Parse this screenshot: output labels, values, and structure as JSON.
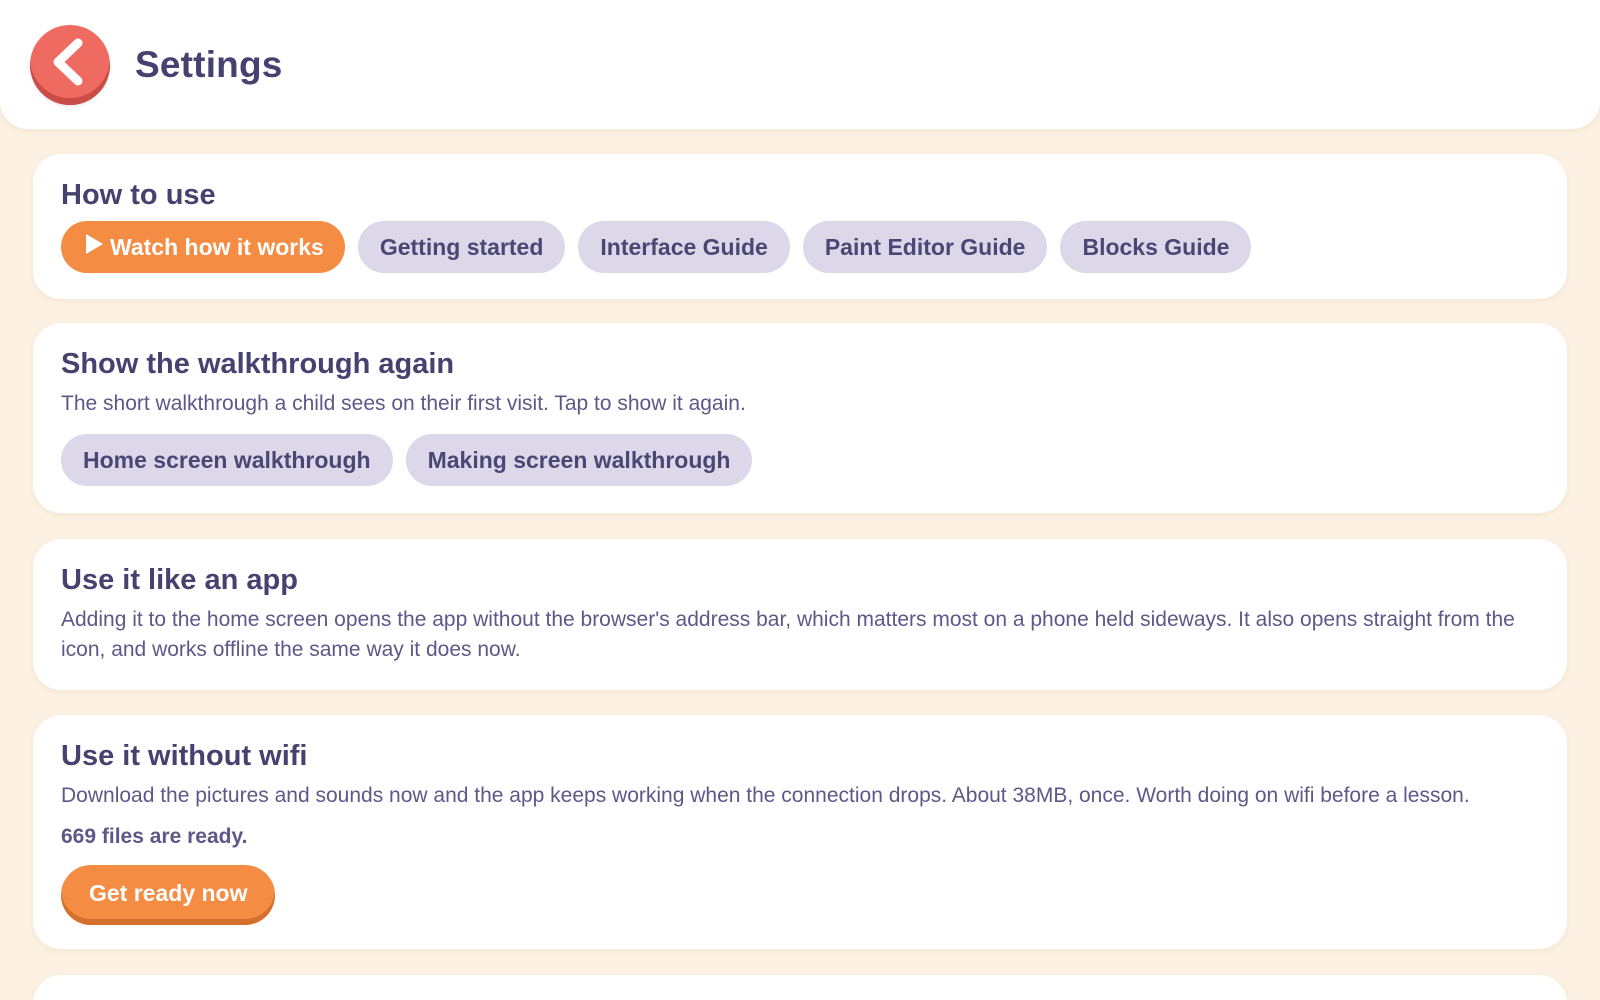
{
  "header": {
    "title": "Settings",
    "back_icon": "chevron-left-icon"
  },
  "colors": {
    "background": "#fcf1e2",
    "accent_orange": "#f58c44",
    "back_red": "#ef6b62",
    "pill_lavender": "#dcd7e9",
    "text_navy": "#45426f"
  },
  "how_to_use": {
    "title": "How to use",
    "buttons": [
      {
        "label": "Watch how it works",
        "icon": "play-icon"
      },
      {
        "label": "Getting started"
      },
      {
        "label": "Interface Guide"
      },
      {
        "label": "Paint Editor Guide"
      },
      {
        "label": "Blocks Guide"
      }
    ]
  },
  "walkthrough": {
    "title": "Show the walkthrough again",
    "description": "The short walkthrough a child sees on their first visit. Tap to show it again.",
    "buttons": [
      {
        "label": "Home screen walkthrough"
      },
      {
        "label": "Making screen walkthrough"
      }
    ]
  },
  "app_mode": {
    "title": "Use it like an app",
    "description": "Adding it to the home screen opens the app without the browser's address bar, which matters most on a phone held sideways. It also opens straight from the icon, and works offline the same way it does now."
  },
  "offline": {
    "title": "Use it without wifi",
    "description": "Download the pictures and sounds now and the app keeps working when the connection drops. About 38MB, once. Worth doing on wifi before a lesson.",
    "status": "669 files are ready.",
    "action_label": "Get ready now"
  }
}
